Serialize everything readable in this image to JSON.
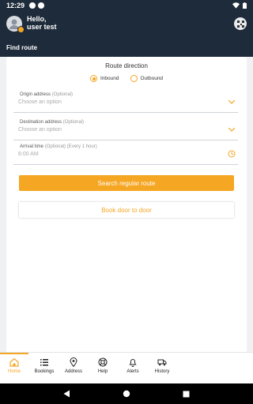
{
  "status_bar": {
    "time": "12:29"
  },
  "header": {
    "greeting": "Hello,",
    "username": "user test",
    "section_title": "Find route"
  },
  "form": {
    "title": "Route direction",
    "direction_options": [
      {
        "label": "Inbound",
        "selected": true
      },
      {
        "label": "Outbound",
        "selected": false
      }
    ],
    "origin": {
      "label": "Origin address",
      "optional": "(Optional)",
      "placeholder": "Choose an option"
    },
    "destination": {
      "label": "Destination address",
      "optional": "(Optional)",
      "placeholder": "Choose an option"
    },
    "arrival": {
      "label": "Arrival time",
      "optional": "(Optional)",
      "hint": "(Every 1 hour)",
      "value": "6:00 AM"
    },
    "search_button": "Search regular route",
    "door_button": "Book door to door"
  },
  "tabs": [
    {
      "label": "Home",
      "icon": "home-icon",
      "active": true
    },
    {
      "label": "Bookings",
      "icon": "list-icon",
      "active": false
    },
    {
      "label": "Address",
      "icon": "location-pin-icon",
      "active": false
    },
    {
      "label": "Help",
      "icon": "lifebuoy-icon",
      "active": false
    },
    {
      "label": "Alerts",
      "icon": "bell-icon",
      "active": false
    },
    {
      "label": "History",
      "icon": "truck-icon",
      "active": false
    }
  ],
  "colors": {
    "accent": "#f5a623",
    "header_bg": "#1e2b3a",
    "page_bg": "#f0f1f3"
  }
}
